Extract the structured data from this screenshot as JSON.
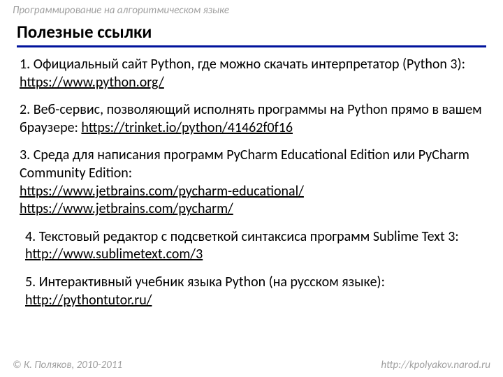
{
  "pretitle": "Программирование на алгоритмическом языке",
  "title": "Полезные ссылки",
  "items": [
    {
      "num": "1.",
      "text": "Официальный сайт Python, где можно скачать интерпретатор (Python 3): ",
      "links": [
        "https://www.python.org/"
      ],
      "indent": false
    },
    {
      "num": "2.",
      "text": "Веб-сервис, позволяющий исполнять программы на Python прямо в вашем браузере: ",
      "links": [
        "https://trinket.io/python/41462f0f16"
      ],
      "indent": false
    },
    {
      "num": "3.",
      "text": "Среда для написания программ PyCharm Educational Edition или PyCharm Community Edition: ",
      "links": [
        "https://www.jetbrains.com/pycharm-educational/",
        "https://www.jetbrains.com/pycharm/"
      ],
      "indent": false,
      "linksBlock": true
    },
    {
      "num": "4.",
      "text": "Текстовый редактор с подсветкой синтаксиса программ Sublime Text 3: ",
      "links": [
        "http://www.sublimetext.com/3"
      ],
      "indent": true
    },
    {
      "num": "5.",
      "text": "Интерактивный учебник языка Python (на русском языке): ",
      "links": [
        "http://pythontutor.ru/"
      ],
      "indent": true
    }
  ],
  "footer": {
    "left": "© К. Поляков, 2010-2011",
    "right": "http://kpolyakov.narod.ru"
  }
}
